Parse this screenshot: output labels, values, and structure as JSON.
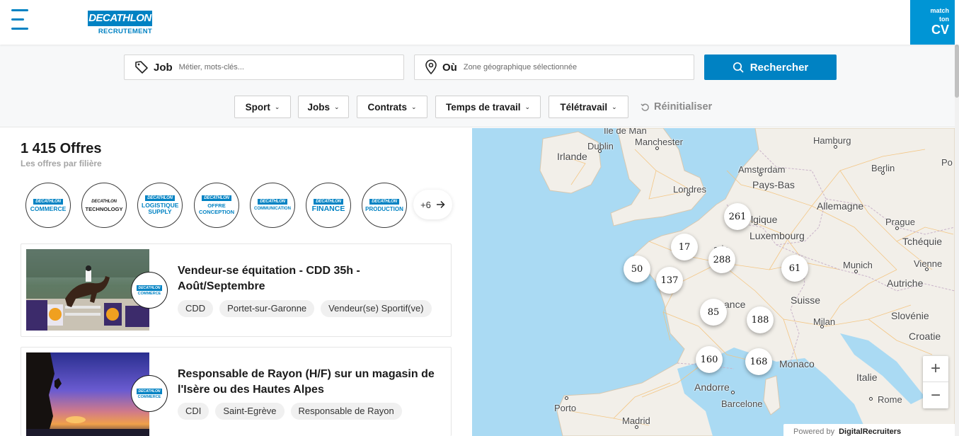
{
  "header": {
    "logo_main": "DECATHLON",
    "logo_sub": "RECRUTEMENT",
    "match_cv_line1": "match",
    "match_cv_line2": "ton",
    "match_cv_line3": "CV"
  },
  "search": {
    "job_label": "Job",
    "job_placeholder": "Métier, mots-clés...",
    "where_label": "Où",
    "where_placeholder": "Zone géographique sélectionnée",
    "button_label": "Rechercher"
  },
  "filters": [
    {
      "label": "Sport"
    },
    {
      "label": "Jobs"
    },
    {
      "label": "Contrats"
    },
    {
      "label": "Temps de travail"
    },
    {
      "label": "Télétravail"
    }
  ],
  "reset_label": "Réinitialiser",
  "results": {
    "count": "1 415 Offres",
    "subtitle": "Les offres par filière"
  },
  "filieres": [
    {
      "brand": "DECATHLON",
      "label": "COMMERCE"
    },
    {
      "brand": "DECATHLON",
      "label": "TECHNOLOGY"
    },
    {
      "brand": "DECATHLON",
      "label": "LOGISTIQUE SUPPLY"
    },
    {
      "brand": "DECATHLON",
      "label": "OFFRE CONCEPTION"
    },
    {
      "brand": "DECATHLON",
      "label": "COMMUNICATION"
    },
    {
      "brand": "DECATHLON",
      "label": "FINANCE"
    },
    {
      "brand": "DECATHLON",
      "label": "PRODUCTION"
    }
  ],
  "more_filieres": "+6",
  "jobs": [
    {
      "title": "Vendeur-se équitation - CDD 35h - Août/Septembre",
      "badge_brand": "DECATHLON",
      "badge_label": "COMMERCE",
      "tags": [
        "CDD",
        "Portet-sur-Garonne",
        "Vendeur(se) Sportif(ve)"
      ]
    },
    {
      "title": "Responsable de Rayon (H/F) sur un magasin de l'Isère ou des Hautes Alpes",
      "badge_brand": "DECATHLON",
      "badge_label": "COMMERCE",
      "tags": [
        "CDI",
        "Saint-Egrève",
        "Responsable de Rayon"
      ]
    }
  ],
  "map": {
    "places": {
      "ile_de_man": "Île de Man",
      "dublin": "Dublin",
      "manchester": "Manchester",
      "hamburg": "Hamburg",
      "po": "Po",
      "irlande": "Irlande",
      "amsterdam": "Amsterdam",
      "berlin": "Berlin",
      "londres": "Londres",
      "pays_bas": "Pays-Bas",
      "allemagne": "Allemagne",
      "lgique": "lgique",
      "prague": "Prague",
      "luxembourg": "Luxembourg",
      "tcheque": "Tchéquie",
      "aris": "aris",
      "munich": "Munich",
      "vienne": "Vienne",
      "autriche": "Autriche",
      "ance": "ance",
      "suisse": "Suisse",
      "slovenie": "Slovénie",
      "milan": "Milan",
      "croatie": "Croatie",
      "monaco": "Monaco",
      "italie": "Italie",
      "andorre": "Andorre",
      "barcelone": "Barcelone",
      "rome": "Rome",
      "porto": "Porto",
      "madrid": "Madrid"
    },
    "clusters": [
      "261",
      "17",
      "288",
      "50",
      "137",
      "61",
      "85",
      "188",
      "160",
      "168"
    ],
    "zoom_in": "+",
    "zoom_out": "−",
    "powered_by": "Powered by",
    "powered_brand": "DigitalRecruiters"
  },
  "colors": {
    "brand_blue": "#0082c3",
    "match_cv_bg": "#0095d5",
    "sea": "#aadaf3",
    "land": "#f2efe9"
  }
}
